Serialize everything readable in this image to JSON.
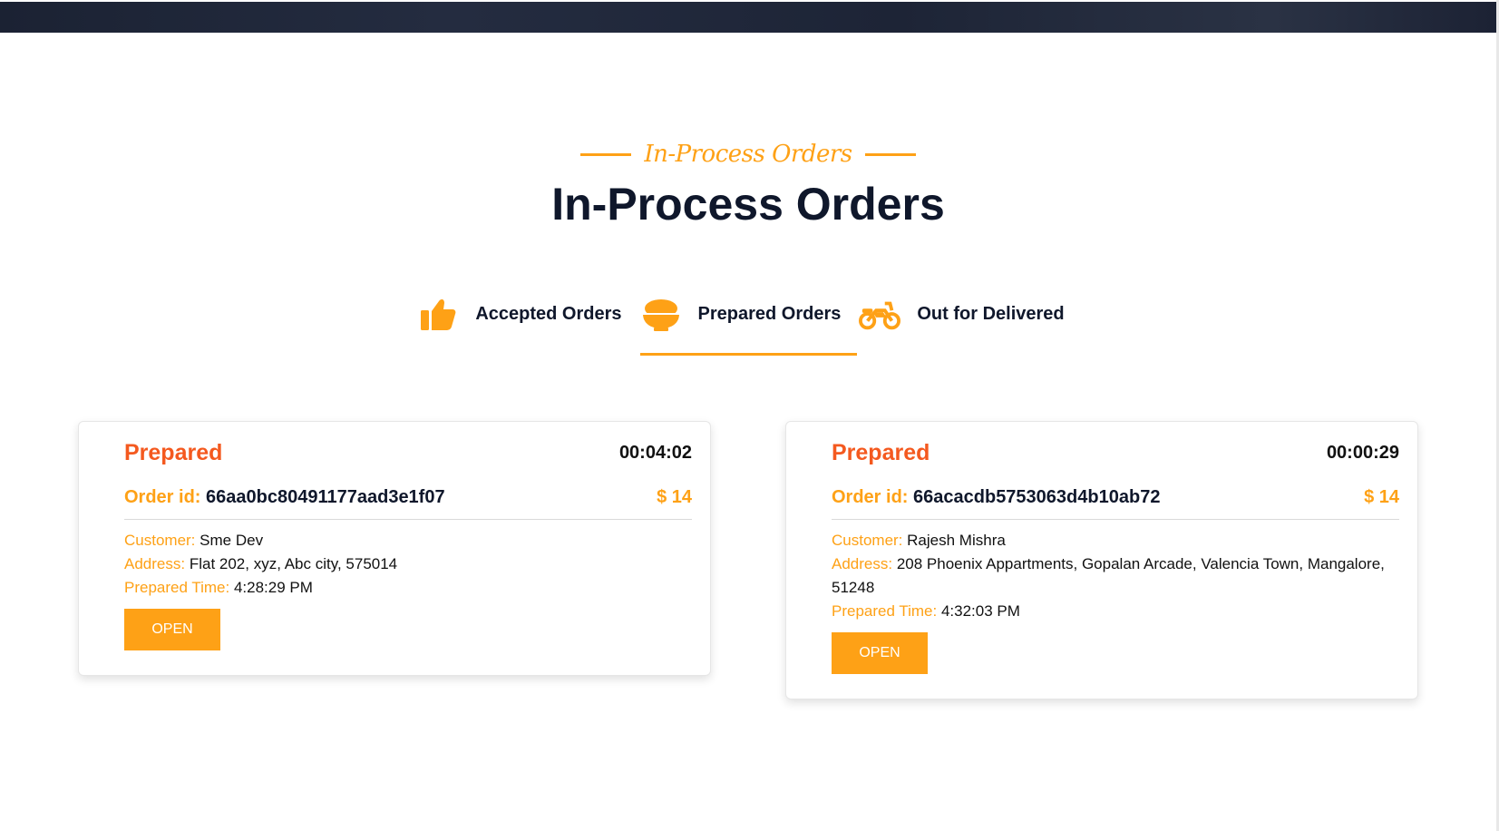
{
  "header": {
    "subtitle": "In-Process Orders",
    "title": "In-Process Orders"
  },
  "tabs": [
    {
      "label": "Accepted Orders",
      "icon": "thumbs-up-icon",
      "active": false
    },
    {
      "label": "Prepared Orders",
      "icon": "bowl-icon",
      "active": true
    },
    {
      "label": "Out for Delivered",
      "icon": "motorcycle-icon",
      "active": false
    }
  ],
  "orders": [
    {
      "status": "Prepared",
      "timer": "00:04:02",
      "order_id_label": "Order id:",
      "order_id": "66aa0bc80491177aad3e1f07",
      "price": "$ 14",
      "customer_label": "Customer:",
      "customer": "Sme Dev",
      "address_label": "Address:",
      "address": "Flat 202, xyz, Abc city, 575014",
      "time_label": "Prepared Time:",
      "time": "4:28:29 PM",
      "button": "OPEN"
    },
    {
      "status": "Prepared",
      "timer": "00:00:29",
      "order_id_label": "Order id:",
      "order_id": "66acacdb5753063d4b10ab72",
      "price": "$ 14",
      "customer_label": "Customer:",
      "customer": "Rajesh Mishra",
      "address_label": "Address:",
      "address": "208 Phoenix Appartments, Gopalan Arcade, Valencia Town, Mangalore, 51248",
      "time_label": "Prepared Time:",
      "time": "4:32:03 PM",
      "button": "OPEN"
    }
  ],
  "colors": {
    "accent": "#fea116",
    "status": "#f4591f",
    "heading": "#0f172b"
  }
}
